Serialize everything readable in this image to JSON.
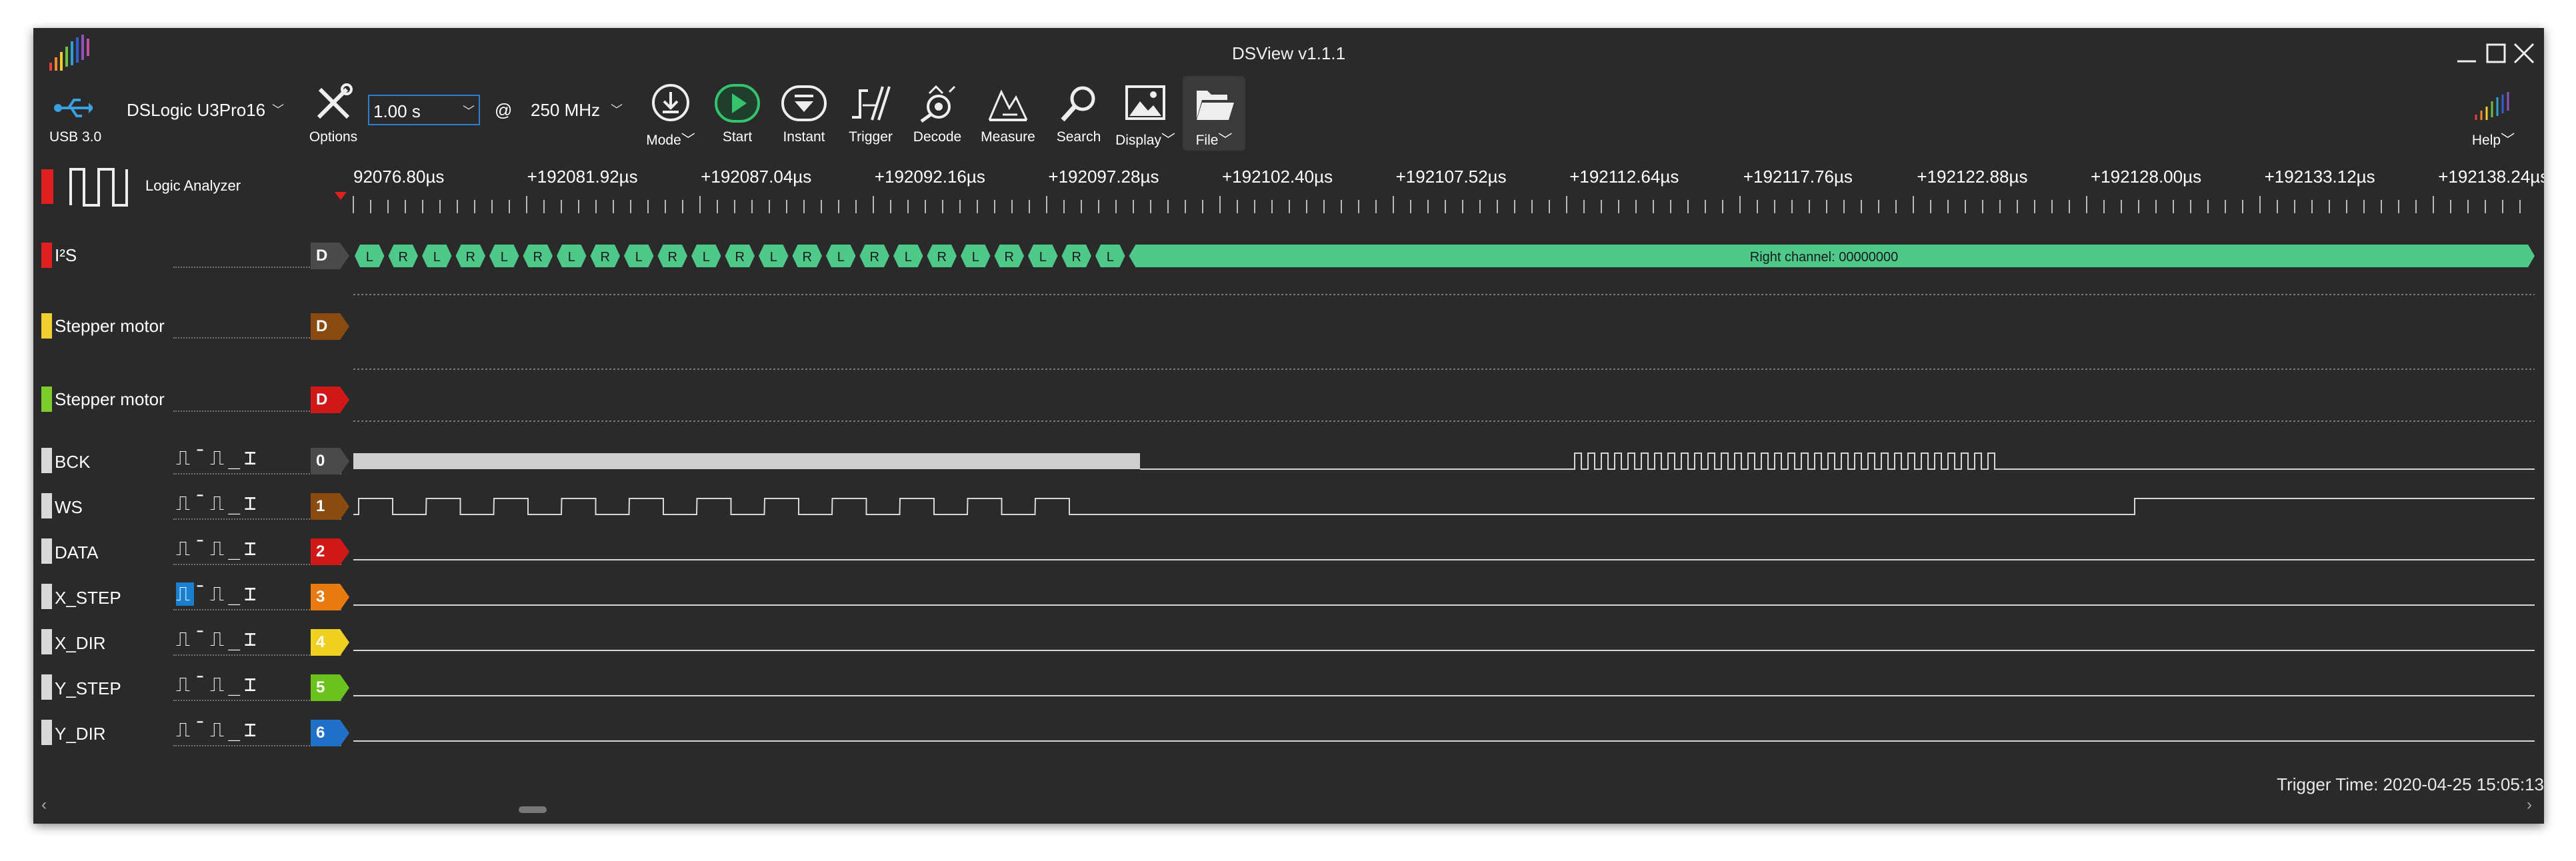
{
  "window": {
    "title": "DSView v1.1.1"
  },
  "toolbar": {
    "usb_label": "USB 3.0",
    "device": "DSLogic U3Pro16",
    "options_label": "Options",
    "duration": "1.00 s",
    "at_symbol": "@",
    "samplerate": "250 MHz",
    "mode_label": "Mode",
    "start_label": "Start",
    "instant_label": "Instant",
    "trigger_label": "Trigger",
    "decode_label": "Decode",
    "measure_label": "Measure",
    "search_label": "Search",
    "display_label": "Display",
    "file_label": "File",
    "help_label": "Help"
  },
  "header": {
    "mode_name": "Logic Analyzer"
  },
  "ruler": {
    "labels": [
      "92076.80µs",
      "+192081.92µs",
      "+192087.04µs",
      "+192092.16µs",
      "+192097.28µs",
      "+192102.40µs",
      "+192107.52µs",
      "+192112.64µs",
      "+192117.76µs",
      "+192122.88µs",
      "+192128.00µs",
      "+192133.12µs",
      "+192138.24µs"
    ]
  },
  "decoders": [
    {
      "name": "I²S",
      "num": "0",
      "badge": "D",
      "color": "#e02020",
      "badge_color": "#4a4a4a"
    },
    {
      "name": "Stepper motor",
      "num": "1",
      "badge": "D",
      "color": "#f0d030",
      "badge_color": "#8a4b10"
    },
    {
      "name": "Stepper motor",
      "num": "2",
      "badge": "D",
      "color": "#7ccc2c",
      "badge_color": "#d01818"
    }
  ],
  "i2s": {
    "items": [
      "L",
      "R",
      "L",
      "R",
      "L",
      "R",
      "L",
      "R",
      "L",
      "R",
      "L",
      "R",
      "L",
      "R",
      "L",
      "R",
      "L",
      "R",
      "L",
      "R",
      "L",
      "R",
      "L"
    ],
    "big_label": "Right channel: 00000000",
    "color": "#4fc98a"
  },
  "channels": [
    {
      "name": "BCK",
      "num": "0",
      "badge_color": "#4a4a4a"
    },
    {
      "name": "WS",
      "num": "1",
      "badge_color": "#8a4b10"
    },
    {
      "name": "DATA",
      "num": "2",
      "badge_color": "#d01818"
    },
    {
      "name": "X_STEP",
      "num": "3",
      "badge_color": "#e77b10"
    },
    {
      "name": "X_DIR",
      "num": "4",
      "badge_color": "#f0d020"
    },
    {
      "name": "Y_STEP",
      "num": "5",
      "badge_color": "#6cc21c"
    },
    {
      "name": "Y_DIR",
      "num": "6",
      "badge_color": "#2070c8"
    }
  ],
  "trigger_glyphs": "⎍¯⎍_⌶",
  "status": {
    "trigger_time": "Trigger Time: 2020-04-25 15:05:13"
  }
}
